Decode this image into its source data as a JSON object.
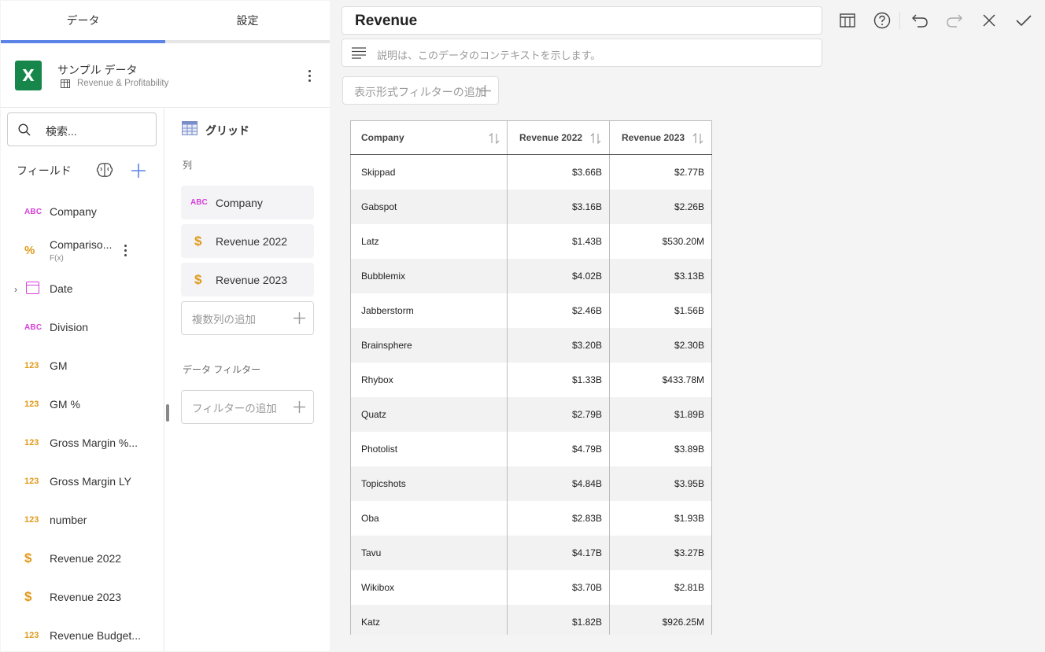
{
  "tabs": {
    "data": "データ",
    "settings": "設定"
  },
  "datasource": {
    "title": "サンプル データ",
    "subtitle": "Revenue & Profitability"
  },
  "search": {
    "placeholder": "検索..."
  },
  "fields_header": "フィールド",
  "fields": [
    {
      "type": "ABC",
      "name": "Company"
    },
    {
      "type": "%",
      "name": "Compariso...",
      "sub": "F(x)"
    },
    {
      "type": "date",
      "name": "Date"
    },
    {
      "type": "ABC",
      "name": "Division"
    },
    {
      "type": "123",
      "name": "GM"
    },
    {
      "type": "123",
      "name": "GM %"
    },
    {
      "type": "123",
      "name": "Gross Margin %..."
    },
    {
      "type": "123",
      "name": "Gross Margin LY"
    },
    {
      "type": "123",
      "name": "number"
    },
    {
      "type": "$",
      "name": "Revenue 2022"
    },
    {
      "type": "$",
      "name": "Revenue 2023"
    },
    {
      "type": "123",
      "name": "Revenue Budget..."
    }
  ],
  "viz": {
    "type_label": "グリッド",
    "columns_label": "列",
    "columns": [
      {
        "type": "ABC",
        "name": "Company"
      },
      {
        "type": "$",
        "name": "Revenue 2022"
      },
      {
        "type": "$",
        "name": "Revenue 2023"
      }
    ],
    "add_columns": "複数列の追加",
    "data_filter_label": "データ フィルター",
    "add_filter": "フィルターの追加"
  },
  "editor": {
    "title": "Revenue",
    "description_placeholder": "説明は、このデータのコンテキストを示します。",
    "format_filter": "表示形式フィルターの追加"
  },
  "colors": {
    "accent": "#5c84e8",
    "excel": "#17864a",
    "abc": "#d53fd9",
    "numeric": "#e09a1a"
  },
  "table": {
    "headers": [
      "Company",
      "Revenue 2022",
      "Revenue 2023"
    ],
    "rows": [
      [
        "Skippad",
        "$3.66B",
        "$2.77B"
      ],
      [
        "Gabspot",
        "$3.16B",
        "$2.26B"
      ],
      [
        "Latz",
        "$1.43B",
        "$530.20M"
      ],
      [
        "Bubblemix",
        "$4.02B",
        "$3.13B"
      ],
      [
        "Jabberstorm",
        "$2.46B",
        "$1.56B"
      ],
      [
        "Brainsphere",
        "$3.20B",
        "$2.30B"
      ],
      [
        "Rhybox",
        "$1.33B",
        "$433.78M"
      ],
      [
        "Quatz",
        "$2.79B",
        "$1.89B"
      ],
      [
        "Photolist",
        "$4.79B",
        "$3.89B"
      ],
      [
        "Topicshots",
        "$4.84B",
        "$3.95B"
      ],
      [
        "Oba",
        "$2.83B",
        "$1.93B"
      ],
      [
        "Tavu",
        "$4.17B",
        "$3.27B"
      ],
      [
        "Wikibox",
        "$3.70B",
        "$2.81B"
      ],
      [
        "Katz",
        "$1.82B",
        "$926.25M"
      ]
    ]
  }
}
